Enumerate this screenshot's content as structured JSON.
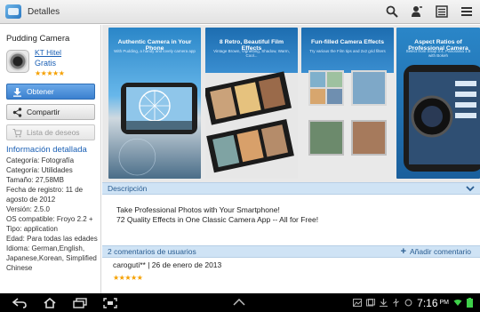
{
  "header": {
    "title": "Detalles"
  },
  "app": {
    "name": "Pudding Camera",
    "developer": "KT Hitel",
    "price": "Gratis",
    "rating_stars": "★★★★★"
  },
  "buttons": {
    "download": "Obtener",
    "share": "Compartir",
    "wishlist": "Lista de deseos"
  },
  "info": {
    "heading": "Información detallada",
    "items": [
      "Categoría: Fotografía",
      "Categoría: Utilidades",
      "Tamaño: 27,58MB",
      "Fecha de registro: 11 de agosto de 2012",
      "Versión: 2.5.0",
      "OS compatible: Froyo 2.2 +",
      "Tipo: application",
      "Edad: Para todas las edades",
      "Idioma: German,English, Japanese,Korean, Simplified Chinese"
    ]
  },
  "screenshots": [
    {
      "caption": "Authentic Camera in Your Phone",
      "sub": "With Pudding, a handy and lovely camera app"
    },
    {
      "caption": "8 Retro, Beautiful Film Effects",
      "sub": "Vintage Brown, Vignetting, Shadow, Warm, Cool..."
    },
    {
      "caption": "Fun-filled Camera Effects",
      "sub": "Try various the Film tips and 2x2 grid filters"
    },
    {
      "caption": "Aspect Ratios of Professional Camera",
      "sub": "Select from Snap 3:4, Panorama 1:8 with Bokeh"
    }
  ],
  "description": {
    "label": "Descripción",
    "line1": "Take Professional Photos with Your Smartphone!",
    "line2": "72 Quality Effects in One Classic Camera App -- All for Free!"
  },
  "comments": {
    "label": "2 comentarios de usuarios",
    "add_label": "Añadir comentario",
    "first_author": "caroguti** | 26 de enero de 2013",
    "first_stars": "★★★★★"
  },
  "status": {
    "time": "7:16",
    "ampm": "PM"
  },
  "colors": {
    "accent": "#3a80cf",
    "section_bar": "#cfe3f5",
    "link": "#1a5fb4",
    "stars": "#f5a000"
  }
}
